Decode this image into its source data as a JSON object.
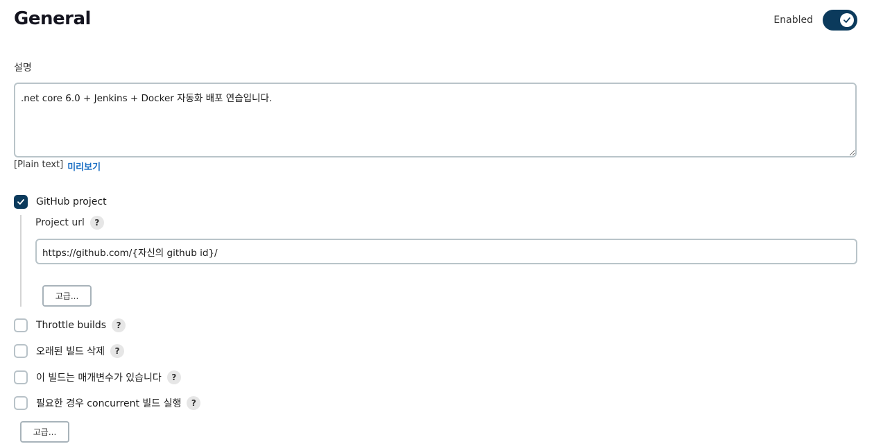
{
  "header": {
    "title": "General",
    "enabled_label": "Enabled",
    "enabled": true,
    "toggle_color": "#0b3a5c"
  },
  "description": {
    "label": "설명",
    "value": ".net core 6.0 + Jenkins + Docker 자동화 배포 연습입니다.",
    "format_label": "[Plain text]",
    "preview_link": "미리보기"
  },
  "github_project": {
    "label": "GitHub project",
    "checked": true,
    "project_url_label": "Project url",
    "project_url_value": "https://github.com/{자신의 github id}/",
    "advanced_button": "고급..."
  },
  "options": [
    {
      "label": "Throttle builds",
      "checked": false
    },
    {
      "label": "오래된 빌드 삭제",
      "checked": false
    },
    {
      "label": "이 빌드는 매개변수가 있습니다",
      "checked": false
    },
    {
      "label": "필요한 경우 concurrent 빌드 실행",
      "checked": false
    }
  ],
  "advanced_button": "고급...",
  "help_icon_text": "?",
  "accent_color": "#0b3a5c",
  "link_color": "#1a6fc4"
}
